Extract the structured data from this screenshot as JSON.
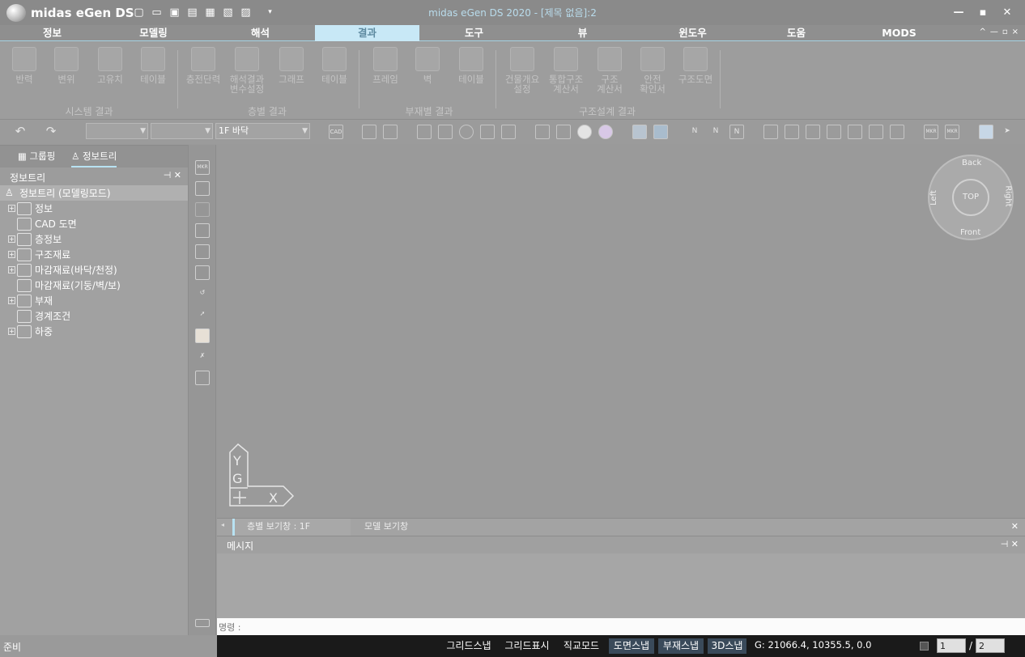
{
  "app": {
    "logo_text": "midas eGen DS",
    "window_title": "midas eGen DS 2020 - [제목 없음]:2"
  },
  "quick_access": [
    "new-file-icon",
    "open-folder-icon",
    "save-icon",
    "save-as-icon",
    "print-icon",
    "print-preview-icon",
    "new-file-icon",
    "dropdown-arrow-icon"
  ],
  "window_controls": {
    "minimize": "—",
    "maximize": "▪",
    "close": "✕"
  },
  "ribbon_tabs": [
    "정보",
    "모델링",
    "해석",
    "결과",
    "도구",
    "뷰",
    "윈도우",
    "도움",
    "MODS"
  ],
  "active_tab": "결과",
  "ribbon_tab_controls": [
    "^",
    "—",
    "▫",
    "×"
  ],
  "ribbon": {
    "buttons": [
      {
        "label": "반력"
      },
      {
        "label": "변위"
      },
      {
        "label": "고유치"
      },
      {
        "label": "테이블"
      },
      {
        "label": "층전단력"
      },
      {
        "label": "해석결과\n변수설정"
      },
      {
        "label": "그래프"
      },
      {
        "label": "테이블"
      },
      {
        "label": "프레임"
      },
      {
        "label": "벽"
      },
      {
        "label": "테이블"
      },
      {
        "label": "건물개요\n설정"
      },
      {
        "label": "통합구조\n계산서"
      },
      {
        "label": "구조\n계산서"
      },
      {
        "label": "안전\n확인서"
      },
      {
        "label": "구조도면"
      }
    ],
    "groups": [
      "시스템 결과",
      "층별 결과",
      "부재별 결과",
      "구조설계 결과"
    ]
  },
  "toolbar": {
    "floor_select": "1F 바닥",
    "cad_icon_label": "CAD",
    "mkr_label": "MKR"
  },
  "left_panel": {
    "tabs": [
      "그룹핑",
      "정보트리"
    ],
    "active_tab": "정보트리",
    "header": "정보트리",
    "header_controls": "⊣ ✕",
    "tree": [
      {
        "label": "정보트리 (모델링모드)",
        "root": true
      },
      {
        "label": "정보",
        "expand": true
      },
      {
        "label": "CAD 도면",
        "expand": false
      },
      {
        "label": "층정보",
        "expand": true
      },
      {
        "label": "구조재료",
        "expand": true
      },
      {
        "label": "마감재료(바닥/천정)",
        "expand": true
      },
      {
        "label": "마감재료(기둥/벽/보)",
        "expand": false
      },
      {
        "label": "부재",
        "expand": true
      },
      {
        "label": "경계조건",
        "expand": false
      },
      {
        "label": "하중",
        "expand": true
      }
    ]
  },
  "viewport": {
    "navcube": {
      "top": "TOP",
      "back": "Back",
      "front": "Front",
      "left": "Left",
      "right": "Right"
    },
    "axis": {
      "y": "Y",
      "g": "G",
      "x": "X"
    }
  },
  "view_tabs": [
    "층별 보기창 : 1F",
    "모델 보기창"
  ],
  "messages": {
    "header": "메시지",
    "command_prompt": "명령 :"
  },
  "status": {
    "ready": "준비",
    "snaps": [
      {
        "label": "그리드스냅",
        "on": false
      },
      {
        "label": "그리드표시",
        "on": false
      },
      {
        "label": "직교모드",
        "on": false
      },
      {
        "label": "도면스냅",
        "on": true
      },
      {
        "label": "부재스냅",
        "on": true
      },
      {
        "label": "3D스냅",
        "on": true
      }
    ],
    "coordinates": "G: 21066.4, 10355.5, 0.0",
    "page_current": "1",
    "page_sep": "/",
    "page_total": "2"
  }
}
